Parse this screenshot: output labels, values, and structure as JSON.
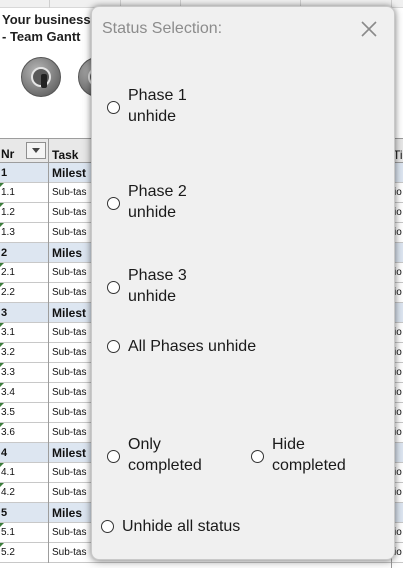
{
  "spreadsheet": {
    "banner_line1": "Your business",
    "banner_line2": "- Team Gantt",
    "buttons": [
      {
        "icon": "traffic-light-icon"
      },
      {
        "icon": "gear-icon"
      }
    ],
    "header": {
      "nr": "Nr",
      "task": "Task",
      "ti": "Ti"
    },
    "rows": [
      {
        "nr": "1",
        "task": "Milest",
        "ti": "",
        "milestone": true
      },
      {
        "nr": "1.1",
        "task": "Sub-tas",
        "ti": "io",
        "milestone": false
      },
      {
        "nr": "1.2",
        "task": "Sub-tas",
        "ti": "io",
        "milestone": false
      },
      {
        "nr": "1.3",
        "task": "Sub-tas",
        "ti": "io",
        "milestone": false
      },
      {
        "nr": "2",
        "task": "Miles",
        "ti": "",
        "milestone": true
      },
      {
        "nr": "2.1",
        "task": "Sub-tas",
        "ti": "io",
        "milestone": false
      },
      {
        "nr": "2.2",
        "task": "Sub-tas",
        "ti": "io",
        "milestone": false
      },
      {
        "nr": "3",
        "task": "Milest",
        "ti": "",
        "milestone": true
      },
      {
        "nr": "3.1",
        "task": "Sub-tas",
        "ti": "io",
        "milestone": false
      },
      {
        "nr": "3.2",
        "task": "Sub-tas",
        "ti": "io",
        "milestone": false
      },
      {
        "nr": "3.3",
        "task": "Sub-tas",
        "ti": "io",
        "milestone": false
      },
      {
        "nr": "3.4",
        "task": "Sub-tas",
        "ti": "io",
        "milestone": false
      },
      {
        "nr": "3.5",
        "task": "Sub-tas",
        "ti": "io",
        "milestone": false
      },
      {
        "nr": "3.6",
        "task": "Sub-tas",
        "ti": "io",
        "milestone": false
      },
      {
        "nr": "4",
        "task": "Milest",
        "ti": "",
        "milestone": true
      },
      {
        "nr": "4.1",
        "task": "Sub-tas",
        "ti": "io",
        "milestone": false
      },
      {
        "nr": "4.2",
        "task": "Sub-tas",
        "ti": "io",
        "milestone": false
      },
      {
        "nr": "5",
        "task": "Miles",
        "ti": "",
        "milestone": true
      },
      {
        "nr": "5.1",
        "task": "Sub-tas",
        "ti": "io",
        "milestone": false
      },
      {
        "nr": "5.2",
        "task": "Sub-tas",
        "ti": "io",
        "milestone": false
      }
    ]
  },
  "dialog": {
    "title": "Status Selection:",
    "close_icon": "close-icon",
    "options": {
      "phase1": "Phase 1\nunhide",
      "phase2": "Phase 2\nunhide",
      "phase3": "Phase 3\nunhide",
      "all_phases": "All Phases unhide",
      "only_completed": "Only\ncompleted",
      "hide_completed": "Hide\ncompleted",
      "unhide_all_status": "Unhide all status"
    },
    "colors": {
      "background": "#f0f0f0",
      "title": "#8c8c8c"
    }
  }
}
